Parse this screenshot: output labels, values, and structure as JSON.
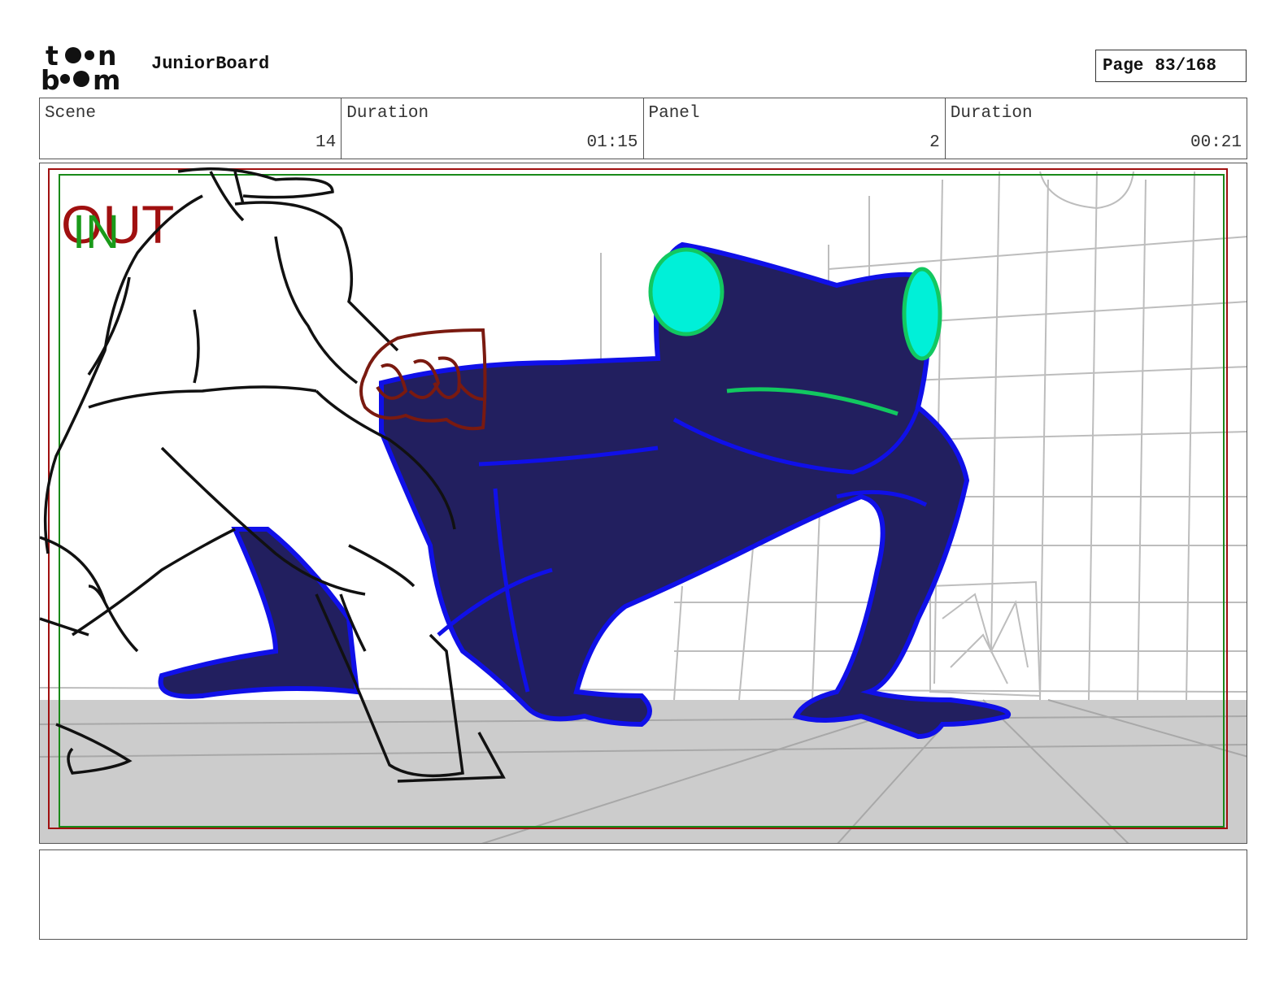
{
  "header": {
    "app_title": "JuniorBoard",
    "logo_text": "toon boom",
    "page_label": "Page",
    "page_value": "83/168"
  },
  "info": {
    "scene_label": "Scene",
    "scene_value": "14",
    "scene_duration_label": "Duration",
    "scene_duration_value": "01:15",
    "panel_label": "Panel",
    "panel_value": "2",
    "panel_duration_label": "Duration",
    "panel_duration_value": "00:21"
  },
  "frame": {
    "out_label": "OUT",
    "in_label": "IN",
    "out_color": "#a01010",
    "in_color": "#1a9a1a"
  },
  "colors": {
    "frog_fill": "#221f5f",
    "frog_outline": "#1010e8",
    "eye_fill": "#00f0d8",
    "eye_outline": "#12c860",
    "fist": "#7a1a10",
    "sketch": "#111111",
    "background_sketch": "#bdbdbd",
    "floor": "#cccccc"
  },
  "notes": {
    "text": ""
  }
}
